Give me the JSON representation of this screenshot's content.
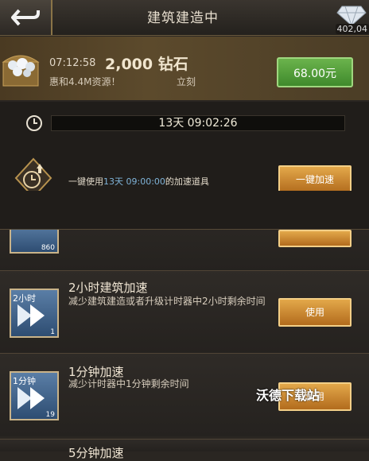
{
  "header": {
    "title": "建筑建造中",
    "diamond_count": "402,04"
  },
  "offer": {
    "time": "07:12:58",
    "amount": "2,000 钻石",
    "desc": "惠和4.4M资源！",
    "instant": "立刻",
    "price": "68.00元",
    "dots_total": 4,
    "dots_active": 0
  },
  "timer": {
    "remaining": "13天 09:02:26",
    "oneclick_prefix": "一键使用",
    "oneclick_time": "13天 09:00:00",
    "oneclick_suffix": "的加速道具",
    "oneclick_button": "一键加速"
  },
  "items": [
    {
      "count": "860",
      "button": ""
    },
    {
      "thumb_label": "2小时",
      "title": "2小时建筑加速",
      "desc": "减少建筑建造或者升级计时器中2小时剩余时间",
      "count": "1",
      "button": "使用"
    },
    {
      "thumb_label": "1分钟",
      "title": "1分钟加速",
      "desc": "减少计时器中1分钟剩余时间",
      "count": "19",
      "button": "使用"
    },
    {
      "title": "5分钟加速"
    }
  ],
  "watermark": "沃德下载站",
  "colors": {
    "accent_gold": "#d9a24a",
    "price_green": "#4f9b36",
    "highlight_blue": "#7fb3d8"
  }
}
